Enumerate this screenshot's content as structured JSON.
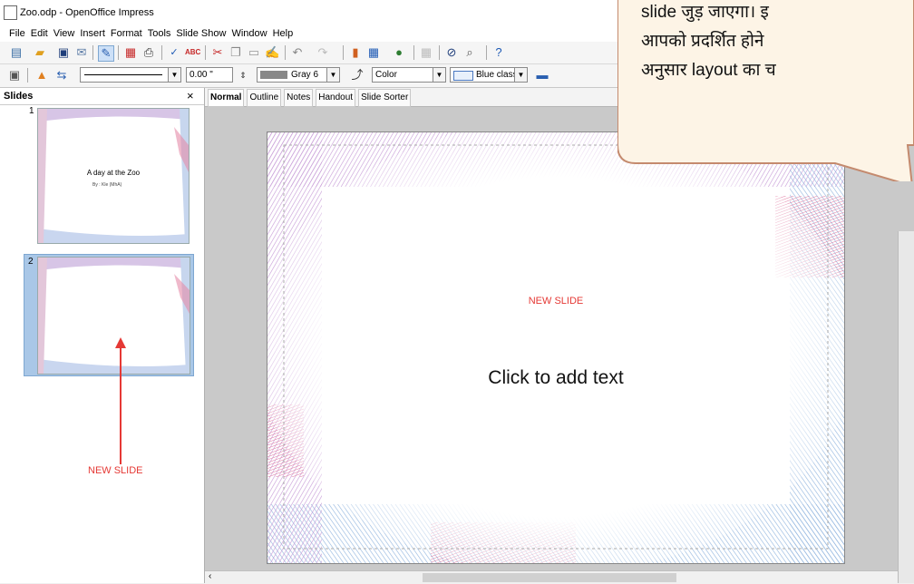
{
  "window": {
    "title": "Zoo.odp - OpenOffice Impress"
  },
  "menu": [
    "File",
    "Edit",
    "View",
    "Insert",
    "Format",
    "Tools",
    "Slide Show",
    "Window",
    "Help"
  ],
  "format_toolbar": {
    "angle_value": "0.00 \"",
    "line_color": "Gray 6",
    "area_style": "Color",
    "area_fill": "Blue classic"
  },
  "slides_pane": {
    "title": "Slides",
    "close_symbol": "×",
    "slides": [
      {
        "number": "1",
        "title": "A day at the Zoo",
        "subtitle": "By : Kle (MhA)"
      },
      {
        "number": "2"
      }
    ]
  },
  "view_tabs": [
    "Normal",
    "Outline",
    "Notes",
    "Handout",
    "Slide Sorter"
  ],
  "slide": {
    "label": "NEW SLIDE",
    "placeholder": "Click to add text"
  },
  "annotation": {
    "label": "NEW SLIDE"
  },
  "callout": {
    "lines": [
      "slide जुड़ जाएगा। इ",
      "आपको प्रदर्शित होने",
      "अनुसार layout का च"
    ]
  },
  "colors": {
    "annotation": "#e53935",
    "callout_fill": "#fdf4e6",
    "callout_border": "#c48a6e",
    "selection": "#a9c7e7"
  },
  "icons": [
    "new-icon",
    "open-icon",
    "save-icon",
    "email-icon",
    "edit-icon",
    "pdf-icon",
    "print-icon",
    "spellcheck-icon",
    "autospell-icon",
    "cut-icon",
    "copy-icon",
    "paste-icon",
    "clone-format-icon",
    "undo-icon",
    "redo-icon",
    "chart-icon",
    "table-icon",
    "hyperlink-icon",
    "grid-icon",
    "navigator-icon",
    "zoom-icon",
    "help-icon"
  ]
}
